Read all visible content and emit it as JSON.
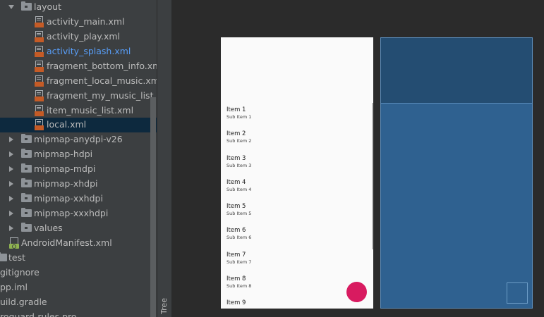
{
  "project_tree": {
    "rows": [
      {
        "label": "layout",
        "type": "folder",
        "expanded": true
      },
      {
        "label": "activity_main.xml",
        "type": "xml"
      },
      {
        "label": "activity_play.xml",
        "type": "xml"
      },
      {
        "label": "activity_splash.xml",
        "type": "xml",
        "highlighted": true
      },
      {
        "label": "fragment_bottom_info.xml",
        "type": "xml"
      },
      {
        "label": "fragment_local_music.xml",
        "type": "xml"
      },
      {
        "label": "fragment_my_music_list.xml",
        "type": "xml"
      },
      {
        "label": "item_music_list.xml",
        "type": "xml"
      },
      {
        "label": "local.xml",
        "type": "xml",
        "selected": true
      },
      {
        "label": "mipmap-anydpi-v26",
        "type": "folder",
        "expanded": false
      },
      {
        "label": "mipmap-hdpi",
        "type": "folder",
        "expanded": false
      },
      {
        "label": "mipmap-mdpi",
        "type": "folder",
        "expanded": false
      },
      {
        "label": "mipmap-xhdpi",
        "type": "folder",
        "expanded": false
      },
      {
        "label": "mipmap-xxhdpi",
        "type": "folder",
        "expanded": false
      },
      {
        "label": "mipmap-xxxhdpi",
        "type": "folder",
        "expanded": false
      },
      {
        "label": "values",
        "type": "folder",
        "expanded": false
      },
      {
        "label": "AndroidManifest.xml",
        "type": "manifest"
      },
      {
        "label": "test",
        "type": "folder-plain"
      },
      {
        "label": "gitignore",
        "type": "file"
      },
      {
        "label": "pp.iml",
        "type": "file"
      },
      {
        "label": "uild.gradle",
        "type": "file"
      },
      {
        "label": "roguard-rules.pro",
        "type": "file"
      }
    ]
  },
  "side_tool_tab": {
    "label": "Tree"
  },
  "design_preview": {
    "list_items": [
      {
        "title": "Item 1",
        "subtitle": "Sub Item 1"
      },
      {
        "title": "Item 2",
        "subtitle": "Sub Item 2"
      },
      {
        "title": "Item 3",
        "subtitle": "Sub Item 3"
      },
      {
        "title": "Item 4",
        "subtitle": "Sub Item 4"
      },
      {
        "title": "Item 5",
        "subtitle": "Sub Item 5"
      },
      {
        "title": "Item 6",
        "subtitle": "Sub Item 6"
      },
      {
        "title": "Item 7",
        "subtitle": "Sub Item 7"
      },
      {
        "title": "Item 8",
        "subtitle": "Sub Item 8"
      },
      {
        "title": "Item 9",
        "subtitle": ""
      }
    ],
    "fab_color": "#d81b60"
  },
  "colors": {
    "tree_background": "#3c3f41",
    "selection": "#0d293e",
    "link_text": "#589df6",
    "blueprint": "#2f6190"
  }
}
